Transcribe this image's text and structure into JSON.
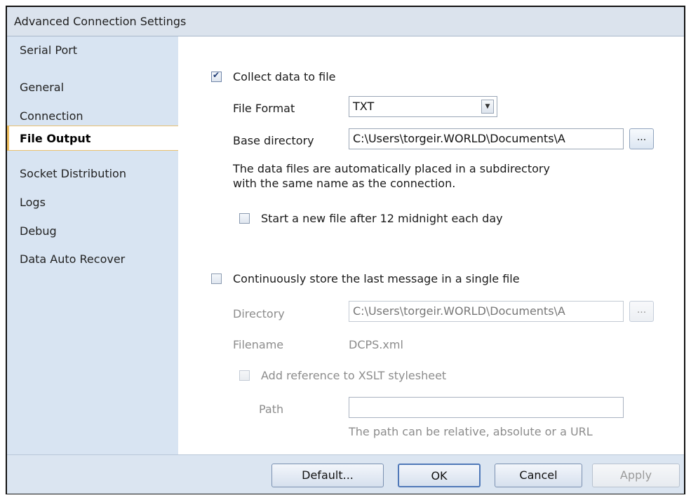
{
  "window": {
    "title": "Advanced Connection Settings"
  },
  "sidebar": {
    "items": [
      {
        "label": "Serial Port"
      },
      {
        "label": "General"
      },
      {
        "label": "Connection"
      },
      {
        "label": "File Output",
        "active": true
      },
      {
        "label": "Socket Distribution"
      },
      {
        "label": "Logs"
      },
      {
        "label": "Debug"
      },
      {
        "label": "Data Auto Recover"
      }
    ]
  },
  "file_output": {
    "collect_checkbox": {
      "label": "Collect data to file",
      "checked": true
    },
    "file_format": {
      "label": "File Format",
      "value": "TXT"
    },
    "base_directory": {
      "label": "Base directory",
      "value": "C:\\Users\\torgeir.WORLD\\Documents\\A",
      "browse_label": "..."
    },
    "info_line1": "The data files are automatically placed in a subdirectory",
    "info_line2": "with the same name as the connection.",
    "new_file_checkbox": {
      "label": "Start a new file after 12 midnight each day",
      "checked": false
    },
    "continuous_checkbox": {
      "label": "Continuously store the last message in a single file",
      "checked": false
    },
    "directory": {
      "label": "Directory",
      "value": "C:\\Users\\torgeir.WORLD\\Documents\\A",
      "browse_label": "..."
    },
    "filename": {
      "label": "Filename",
      "value": "DCPS.xml"
    },
    "xslt_checkbox": {
      "label": "Add reference to XSLT stylesheet",
      "checked": false
    },
    "path": {
      "label": "Path",
      "value": "",
      "hint": "The path can be relative, absolute or a URL"
    }
  },
  "footer": {
    "default_label": "Default...",
    "ok_label": "OK",
    "cancel_label": "Cancel",
    "apply_label": "Apply"
  }
}
